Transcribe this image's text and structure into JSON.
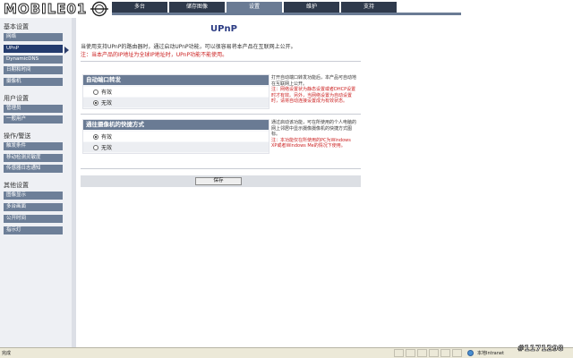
{
  "header": {
    "logo_text": "MOBILE01",
    "tabs": [
      {
        "label": "多台",
        "active": false
      },
      {
        "label": "储存图像",
        "active": false
      },
      {
        "label": "设置",
        "active": true
      },
      {
        "label": "维护",
        "active": false
      },
      {
        "label": "支持",
        "active": false
      }
    ]
  },
  "sidebar": {
    "sections": [
      {
        "title": "基本设置",
        "items": [
          "网络",
          "UPnP",
          "DynamicDNS",
          "日期和时间",
          "摄像机"
        ]
      },
      {
        "title": "用户设置",
        "items": [
          "管理员",
          "一般用户"
        ]
      },
      {
        "title": "操作/警送",
        "items": [
          "触发条件",
          "移动检测灵敏度",
          "传感器日志通知"
        ]
      },
      {
        "title": "其他设置",
        "items": [
          "图像显示",
          "多台画面",
          "公开时间",
          "指示灯"
        ]
      }
    ],
    "active_item": "UPnP"
  },
  "main": {
    "title": "UPnP",
    "desc": "当使用支持UPnP的路由器时，通过启动UPnP功能，可以很容易将本产品在互联网上公开。",
    "desc_note": "注：当本产品的IP地址为全球IP地址时，UPnP功能不能使用。",
    "port_forward": {
      "heading": "自动端口转发",
      "options": [
        "有效",
        "无效"
      ],
      "selected": "无效",
      "help_text": "打开自动端口转发功能后，本产品可自动地在互联网上公开。",
      "help_note": "注：网络设置状为静态设置或者DHCP设置时才有效。另外，当网络设置为自动设置时，请将自动连接设置成为有效状态。"
    },
    "shortcut": {
      "heading": "通往摄像机的快捷方式",
      "options": [
        "有效",
        "无效"
      ],
      "selected": "有效",
      "help_text": "通过启动该功能，可在所使用的个人电脑的网上邻居中显示摄像摄像机的快捷方式图标。",
      "help_note": "注：本功能仅在所使用的PC为Windows XP或者Windows Me的情况下使用。"
    },
    "save_label": "保存"
  },
  "statusbar": {
    "left_text": "完成",
    "zone_label": "本地Intranet"
  },
  "watermark": "#1171298",
  "colors": {
    "tab_dark": "#2f3a4c",
    "tab_active": "#6a7b94",
    "sidebar_item": "#6d7f98",
    "sidebar_active": "#233b6e",
    "title_blue": "#2b3b83",
    "note_red": "#cc2222"
  }
}
